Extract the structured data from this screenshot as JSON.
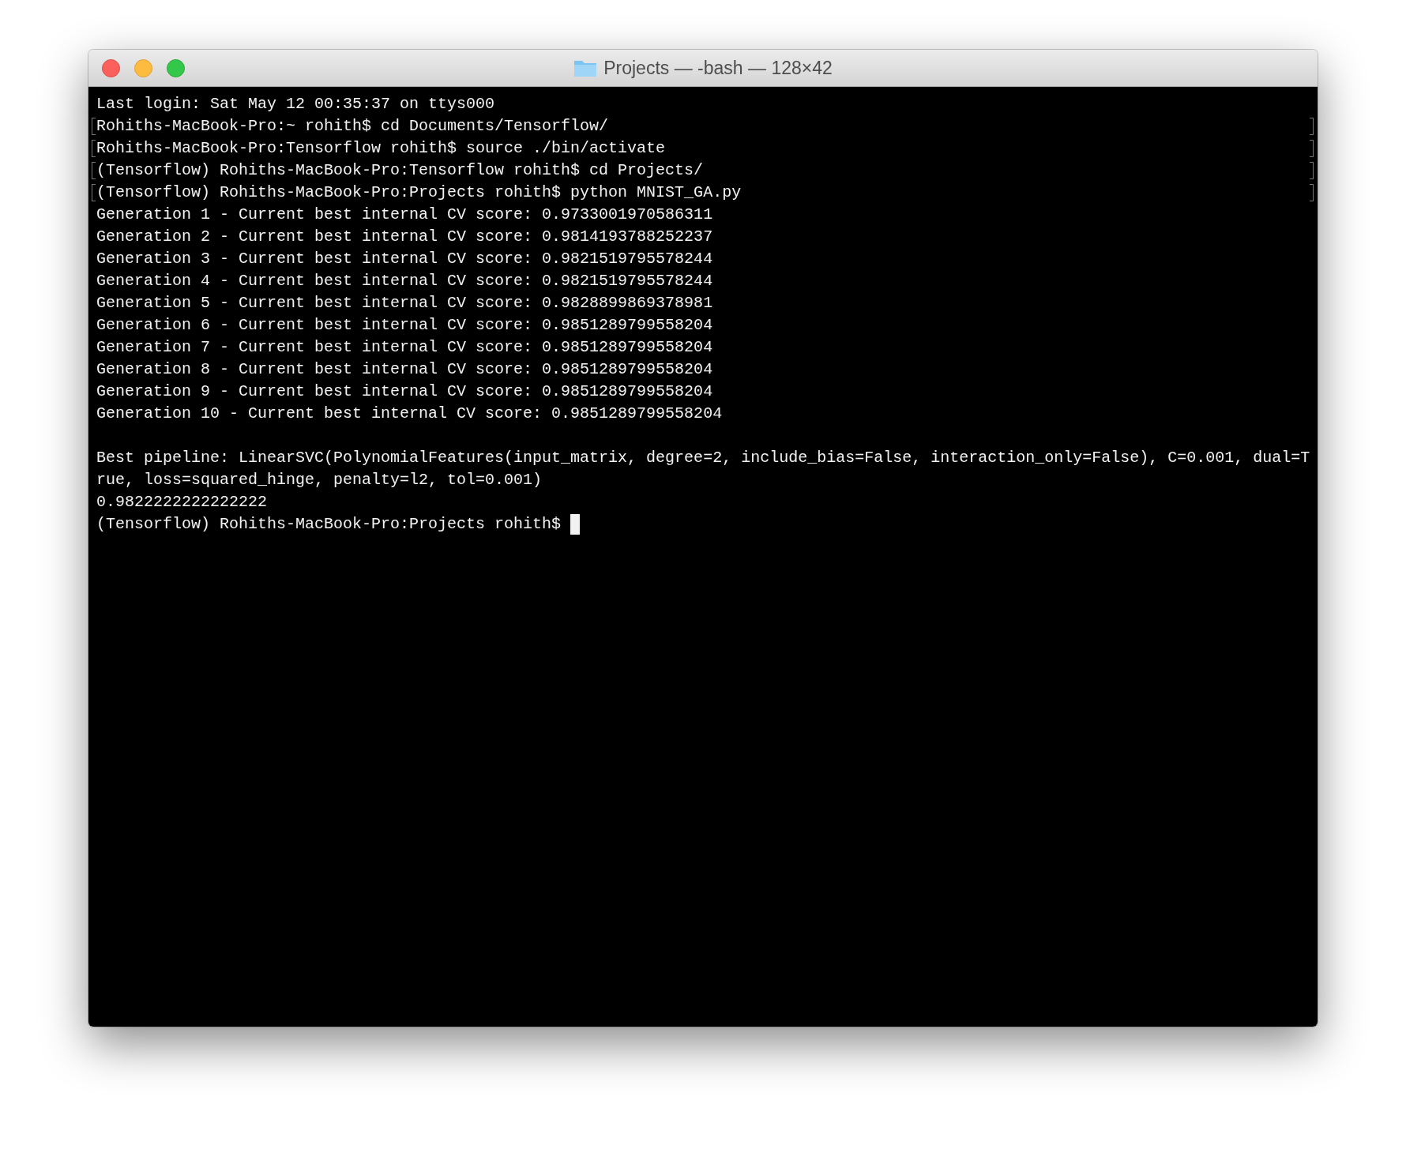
{
  "window": {
    "title": "Projects — -bash — 128×42"
  },
  "lines": [
    {
      "text": "Last login: Sat May 12 00:35:37 on ttys000",
      "marked": false
    },
    {
      "text": "Rohiths-MacBook-Pro:~ rohith$ cd Documents/Tensorflow/",
      "marked": true
    },
    {
      "text": "Rohiths-MacBook-Pro:Tensorflow rohith$ source ./bin/activate",
      "marked": true
    },
    {
      "text": "(Tensorflow) Rohiths-MacBook-Pro:Tensorflow rohith$ cd Projects/",
      "marked": true
    },
    {
      "text": "(Tensorflow) Rohiths-MacBook-Pro:Projects rohith$ python MNIST_GA.py",
      "marked": true
    },
    {
      "text": "Generation 1 - Current best internal CV score: 0.9733001970586311",
      "marked": false
    },
    {
      "text": "Generation 2 - Current best internal CV score: 0.9814193788252237",
      "marked": false
    },
    {
      "text": "Generation 3 - Current best internal CV score: 0.9821519795578244",
      "marked": false
    },
    {
      "text": "Generation 4 - Current best internal CV score: 0.9821519795578244",
      "marked": false
    },
    {
      "text": "Generation 5 - Current best internal CV score: 0.9828899869378981",
      "marked": false
    },
    {
      "text": "Generation 6 - Current best internal CV score: 0.9851289799558204",
      "marked": false
    },
    {
      "text": "Generation 7 - Current best internal CV score: 0.9851289799558204",
      "marked": false
    },
    {
      "text": "Generation 8 - Current best internal CV score: 0.9851289799558204",
      "marked": false
    },
    {
      "text": "Generation 9 - Current best internal CV score: 0.9851289799558204",
      "marked": false
    },
    {
      "text": "Generation 10 - Current best internal CV score: 0.9851289799558204",
      "marked": false
    },
    {
      "text": "Best pipeline: LinearSVC(PolynomialFeatures(input_matrix, degree=2, include_bias=False, interaction_only=False), C=0.001, dual=T",
      "marked": false,
      "gap_before": true
    },
    {
      "text": "rue, loss=squared_hinge, penalty=l2, tol=0.001)",
      "marked": false
    },
    {
      "text": "0.9822222222222222",
      "marked": false
    },
    {
      "text": "(Tensorflow) Rohiths-MacBook-Pro:Projects rohith$",
      "marked": false,
      "cursor": true
    }
  ]
}
